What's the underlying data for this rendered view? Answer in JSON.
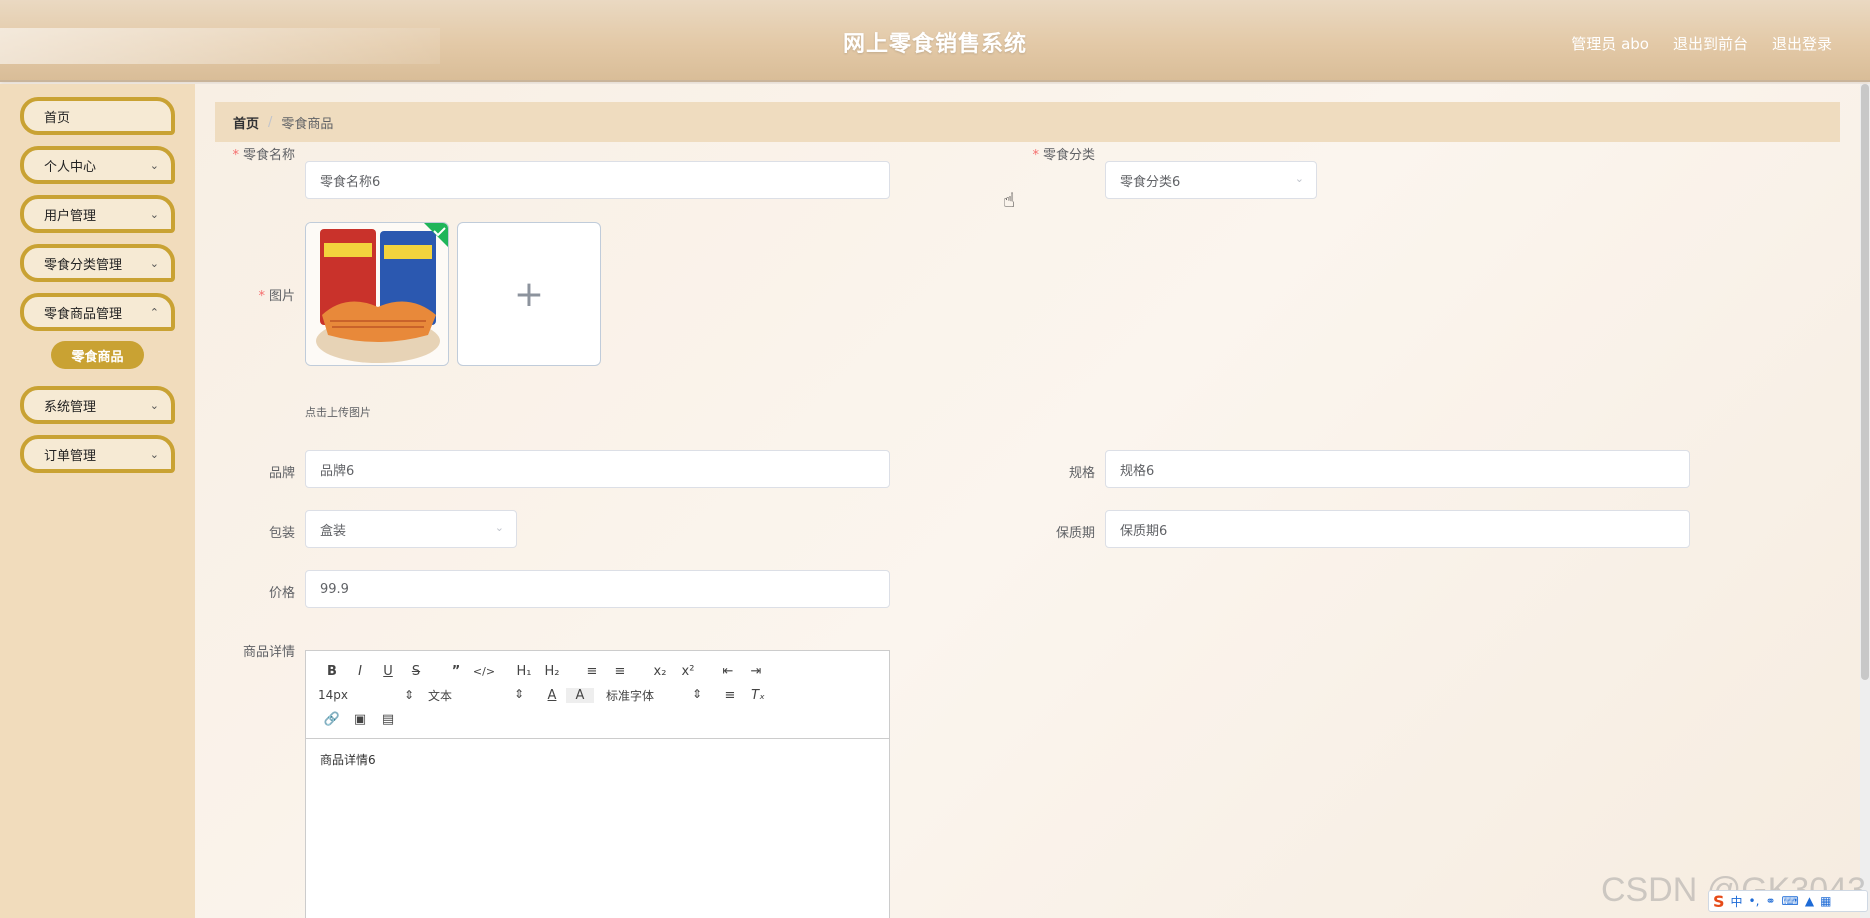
{
  "header": {
    "title": "网上零食销售系统",
    "admin_label": "管理员 abo",
    "to_front_label": "退出到前台",
    "logout_label": "退出登录"
  },
  "sidebar": {
    "items": [
      {
        "label": "首页"
      },
      {
        "label": "个人中心"
      },
      {
        "label": "用户管理"
      },
      {
        "label": "零食分类管理"
      },
      {
        "label": "零食商品管理"
      },
      {
        "label": "系统管理"
      },
      {
        "label": "订单管理"
      }
    ],
    "active_sub": "零食商品"
  },
  "breadcrumb": {
    "home": "首页",
    "separator": "/",
    "current": "零食商品"
  },
  "form": {
    "name": {
      "label": "零食名称",
      "value": "零食名称6"
    },
    "category": {
      "label": "零食分类",
      "value": "零食分类6"
    },
    "image": {
      "label": "图片",
      "tip": "点击上传图片",
      "add_icon": "+"
    },
    "brand": {
      "label": "品牌",
      "value": "品牌6"
    },
    "spec": {
      "label": "规格",
      "value": "规格6"
    },
    "package": {
      "label": "包装",
      "value": "盒装"
    },
    "shelf_life": {
      "label": "保质期",
      "value": "保质期6"
    },
    "price": {
      "label": "价格",
      "value": "99.9"
    },
    "detail": {
      "label": "商品详情",
      "value": "商品详情6"
    }
  },
  "editor": {
    "font_size": "14px",
    "block_type": "文本",
    "font_family": "标准字体"
  },
  "watermark": "CSDN @GK3043",
  "ime": {
    "logo": "S",
    "lang": "中"
  }
}
